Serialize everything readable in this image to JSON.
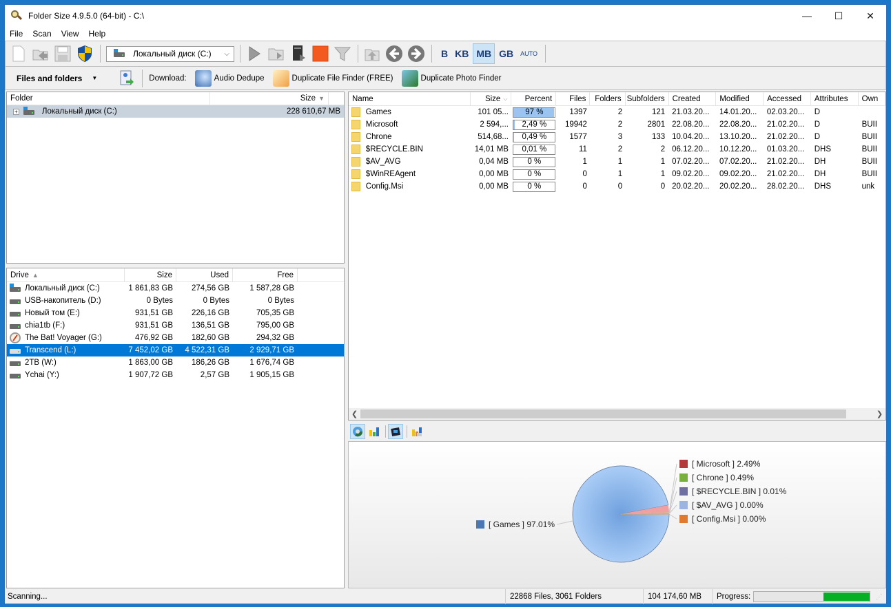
{
  "window": {
    "title": "Folder Size 4.9.5.0 (64-bit) - C:\\",
    "controls": {
      "minimize": "—",
      "maximize": "☐",
      "close": "✕"
    }
  },
  "menu": [
    "File",
    "Scan",
    "View",
    "Help"
  ],
  "toolbar": {
    "icons": [
      "new-icon",
      "open-icon",
      "save-icon",
      "shield-icon"
    ],
    "drive_select": "Локальный диск (C:)",
    "action_icons": [
      "play-icon",
      "scan-folder-icon",
      "scan-computer-icon",
      "stop-icon",
      "filter-icon",
      "up-folder-icon",
      "back-icon",
      "forward-icon"
    ],
    "units": [
      {
        "label": "B",
        "active": false
      },
      {
        "label": "KB",
        "active": false
      },
      {
        "label": "MB",
        "active": true
      },
      {
        "label": "GB",
        "active": false
      },
      {
        "label": "AUTO",
        "active": false
      }
    ]
  },
  "toolbar2": {
    "view_mode": "Files and folders",
    "download_label": "Download:",
    "downloads": [
      "Audio Dedupe",
      "Duplicate File Finder (FREE)",
      "Duplicate Photo Finder"
    ]
  },
  "folder_tree": {
    "headers": {
      "folder": "Folder",
      "size": "Size"
    },
    "rows": [
      {
        "name": "Локальный диск (C:)",
        "size": "228 610,67 MB"
      }
    ]
  },
  "drives": {
    "headers": {
      "drive": "Drive",
      "size": "Size",
      "used": "Used",
      "free": "Free"
    },
    "rows": [
      {
        "name": "Локальный диск (C:)",
        "size": "1 861,83 GB",
        "used": "274,56 GB",
        "free": "1 587,28 GB",
        "icon": "system-drive-icon",
        "selected": false
      },
      {
        "name": "USB-накопитель (D:)",
        "size": "0 Bytes",
        "used": "0 Bytes",
        "free": "0 Bytes",
        "icon": "drive-icon",
        "selected": false
      },
      {
        "name": "Новый том (E:)",
        "size": "931,51 GB",
        "used": "226,16 GB",
        "free": "705,35 GB",
        "icon": "drive-icon",
        "selected": false
      },
      {
        "name": "chia1tb (F:)",
        "size": "931,51 GB",
        "used": "136,51 GB",
        "free": "795,00 GB",
        "icon": "drive-icon",
        "selected": false
      },
      {
        "name": "The Bat! Voyager (G:)",
        "size": "476,92 GB",
        "used": "182,60 GB",
        "free": "294,32 GB",
        "icon": "compass-icon",
        "selected": false
      },
      {
        "name": "Transcend (L:)",
        "size": "7 452,02 GB",
        "used": "4 522,31 GB",
        "free": "2 929,71 GB",
        "icon": "drive-icon",
        "selected": true
      },
      {
        "name": "2TB (W:)",
        "size": "1 863,00 GB",
        "used": "186,26 GB",
        "free": "1 676,74 GB",
        "icon": "drive-icon",
        "selected": false
      },
      {
        "name": "Ychai (Y:)",
        "size": "1 907,72 GB",
        "used": "2,57 GB",
        "free": "1 905,15 GB",
        "icon": "drive-icon",
        "selected": false
      }
    ]
  },
  "files": {
    "headers": [
      "Name",
      "Size",
      "Percent",
      "Files",
      "Folders",
      "Subfolders",
      "Created",
      "Modified",
      "Accessed",
      "Attributes",
      "Own"
    ],
    "rows": [
      {
        "name": "Games",
        "size": "101 05...",
        "percent": "97 %",
        "pct_value": 97,
        "files": "1397",
        "folders": "2",
        "subfolders": "121",
        "created": "21.03.20...",
        "modified": "14.01.20...",
        "accessed": "02.03.20...",
        "attributes": "D",
        "owner": ""
      },
      {
        "name": "Microsoft",
        "size": "2 594,...",
        "percent": "2,49 %",
        "pct_value": 2.49,
        "files": "19942",
        "folders": "2",
        "subfolders": "2801",
        "created": "22.08.20...",
        "modified": "22.08.20...",
        "accessed": "21.02.20...",
        "attributes": "D",
        "owner": "BUII"
      },
      {
        "name": "Chrone",
        "size": "514,68...",
        "percent": "0,49 %",
        "pct_value": 0.49,
        "files": "1577",
        "folders": "3",
        "subfolders": "133",
        "created": "10.04.20...",
        "modified": "13.10.20...",
        "accessed": "21.02.20...",
        "attributes": "D",
        "owner": "BUII"
      },
      {
        "name": "$RECYCLE.BIN",
        "size": "14,01 MB",
        "percent": "0,01 %",
        "pct_value": 0.01,
        "files": "11",
        "folders": "2",
        "subfolders": "2",
        "created": "06.12.20...",
        "modified": "10.12.20...",
        "accessed": "01.03.20...",
        "attributes": "DHS",
        "owner": "BUII"
      },
      {
        "name": "$AV_AVG",
        "size": "0,04 MB",
        "percent": "0 %",
        "pct_value": 0,
        "files": "1",
        "folders": "1",
        "subfolders": "1",
        "created": "07.02.20...",
        "modified": "07.02.20...",
        "accessed": "21.02.20...",
        "attributes": "DH",
        "owner": "BUII"
      },
      {
        "name": "$WinREAgent",
        "size": "0,00 MB",
        "percent": "0 %",
        "pct_value": 0,
        "files": "0",
        "folders": "1",
        "subfolders": "1",
        "created": "09.02.20...",
        "modified": "09.02.20...",
        "accessed": "21.02.20...",
        "attributes": "DH",
        "owner": "BUII"
      },
      {
        "name": "Config.Msi",
        "size": "0,00 MB",
        "percent": "0 %",
        "pct_value": 0,
        "files": "0",
        "folders": "0",
        "subfolders": "0",
        "created": "20.02.20...",
        "modified": "20.02.20...",
        "accessed": "28.02.20...",
        "attributes": "DHS",
        "owner": "unk"
      }
    ]
  },
  "chart_toolbar": [
    "pie-chart-icon",
    "bar-chart-icon",
    "3d-view-icon",
    "export-chart-icon"
  ],
  "chart_data": {
    "type": "pie",
    "title": "",
    "slices": [
      {
        "label": "[ Games ] 97.01%",
        "name": "Games",
        "value": 97.01,
        "color": "#a3c8f2",
        "legend_color": "#4a78b4"
      },
      {
        "label": "[ Microsoft ] 2.49%",
        "name": "Microsoft",
        "value": 2.49,
        "color": "#f0a0a0",
        "legend_color": "#b23a3a"
      },
      {
        "label": "[ Chrone ] 0.49%",
        "name": "Chrone",
        "value": 0.49,
        "color": "#a8d070",
        "legend_color": "#7aae3e"
      },
      {
        "label": "[ $RECYCLE.BIN ] 0.01%",
        "name": "$RECYCLE.BIN",
        "value": 0.01,
        "color": "#8a8ab0",
        "legend_color": "#7070a0"
      },
      {
        "label": "[ $AV_AVG ] 0.00%",
        "name": "$AV_AVG",
        "value": 0.0,
        "color": "#9bb5e0",
        "legend_color": "#9bb5e0"
      },
      {
        "label": "[ Config.Msi ] 0.00%",
        "name": "Config.Msi",
        "value": 0.0,
        "color": "#e8a050",
        "legend_color": "#e07a30"
      }
    ],
    "legend": "left-right"
  },
  "status": {
    "text": "Scanning...",
    "counts": "22868 Files, 3061 Folders",
    "size": "104 174,60 MB",
    "progress_label": "Progress:",
    "progress_fill_start": 0.6,
    "progress_fill_end": 1.0
  }
}
